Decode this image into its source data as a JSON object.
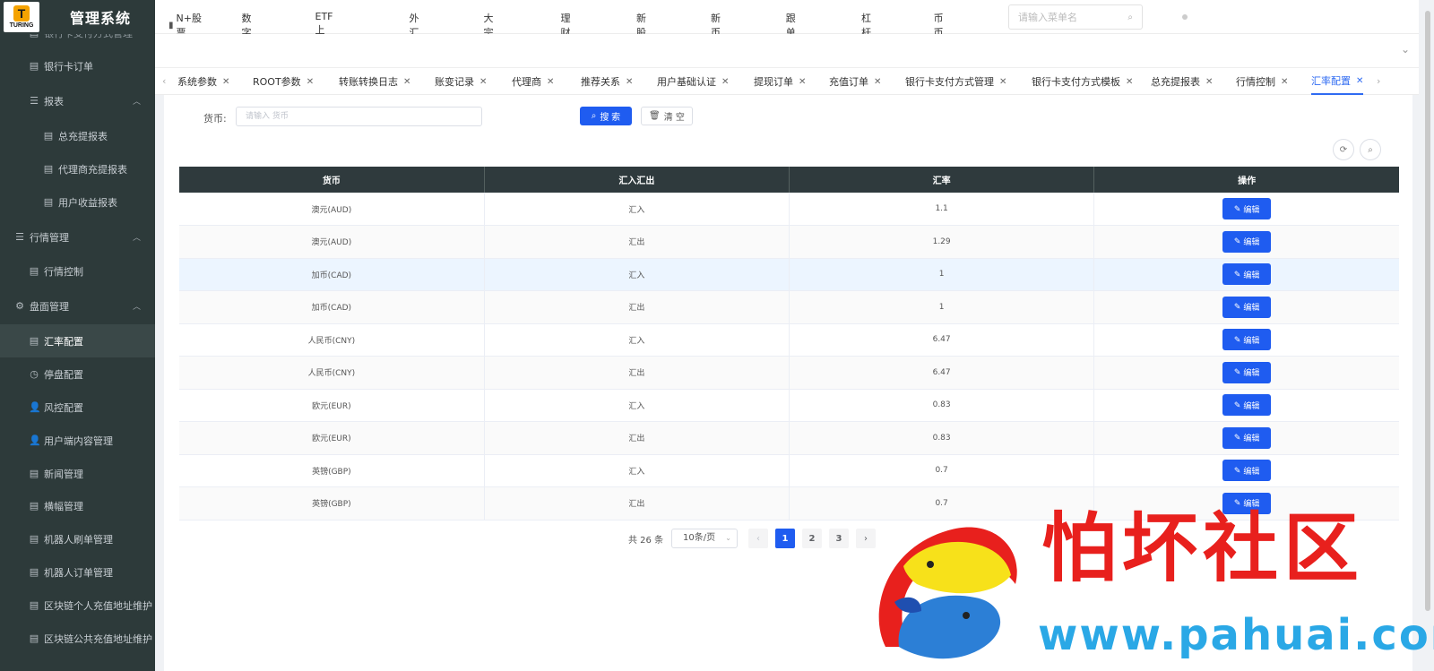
{
  "app": {
    "logo_text": "TURING",
    "logo_mark": "T",
    "title": "管理系统"
  },
  "sidebar": {
    "items": [
      {
        "label": "银行卡支付方式管理",
        "icon": "doc-icon",
        "level": 2
      },
      {
        "label": "银行卡订单",
        "icon": "doc-icon",
        "level": 2
      },
      {
        "label": "报表",
        "icon": "list-icon",
        "level": 2,
        "expanded": true
      },
      {
        "label": "总充提报表",
        "icon": "doc-icon",
        "level": 3
      },
      {
        "label": "代理商充提报表",
        "icon": "doc-icon",
        "level": 3
      },
      {
        "label": "用户收益报表",
        "icon": "doc-icon",
        "level": 3
      },
      {
        "label": "行情管理",
        "icon": "list-icon",
        "level": 1,
        "expanded": true
      },
      {
        "label": "行情控制",
        "icon": "doc-icon",
        "level": 2
      },
      {
        "label": "盘面管理",
        "icon": "gear-icon",
        "level": 1,
        "expanded": true
      },
      {
        "label": "汇率配置",
        "icon": "doc-icon",
        "level": 2,
        "active": true
      },
      {
        "label": "停盘配置",
        "icon": "clock-icon",
        "level": 2
      },
      {
        "label": "风控配置",
        "icon": "user-icon",
        "level": 2
      },
      {
        "label": "用户端内容管理",
        "icon": "user-icon",
        "level": 2
      },
      {
        "label": "新闻管理",
        "icon": "doc-icon",
        "level": 2
      },
      {
        "label": "横幅管理",
        "icon": "doc-icon",
        "level": 2
      },
      {
        "label": "机器人刷单管理",
        "icon": "doc-icon",
        "level": 2
      },
      {
        "label": "机器人订单管理",
        "icon": "doc-icon",
        "level": 2
      },
      {
        "label": "区块链个人充值地址维护",
        "icon": "doc-icon",
        "level": 2
      },
      {
        "label": "区块链公共充值地址维护",
        "icon": "doc-icon",
        "level": 2
      }
    ]
  },
  "topnav": {
    "items": [
      {
        "label": "N+股票",
        "icon": "bar-chart-icon"
      },
      {
        "label": "数字货币",
        "icon": "bar-chart-icon"
      },
      {
        "label": "ETF上市基金",
        "icon": "bar-chart-icon"
      },
      {
        "label": "外汇对冲",
        "icon": "bar-chart-icon"
      },
      {
        "label": "大宗交易",
        "icon": "bar-chart-icon"
      },
      {
        "label": "理财业务",
        "icon": "doc-icon"
      },
      {
        "label": "新股申购",
        "icon": "gear-icon"
      },
      {
        "label": "新币发行",
        "icon": "gear-icon"
      },
      {
        "label": "跟单交易",
        "icon": "clock-icon"
      },
      {
        "label": "杠杆交易",
        "icon": "leverage-icon"
      },
      {
        "label": "币币交易",
        "icon": "pin-icon"
      }
    ],
    "search_placeholder": "请输入菜单名"
  },
  "tabs": [
    {
      "label": "系统参数"
    },
    {
      "label": "ROOT参数"
    },
    {
      "label": "转账转换日志"
    },
    {
      "label": "账变记录"
    },
    {
      "label": "代理商"
    },
    {
      "label": "推荐关系"
    },
    {
      "label": "用户基础认证"
    },
    {
      "label": "提现订单"
    },
    {
      "label": "充值订单"
    },
    {
      "label": "银行卡支付方式管理"
    },
    {
      "label": "银行卡支付方式模板"
    },
    {
      "label": "总充提报表"
    },
    {
      "label": "行情控制"
    },
    {
      "label": "汇率配置",
      "active": true
    }
  ],
  "filter": {
    "label": "货币:",
    "placeholder": "请输入 货币",
    "search_label": "搜 索",
    "clear_label": "清 空"
  },
  "table": {
    "columns": [
      "货币",
      "汇入汇出",
      "汇率",
      "操作"
    ],
    "rows": [
      {
        "currency": "澳元(AUD)",
        "direction": "汇入",
        "rate": "1.1"
      },
      {
        "currency": "澳元(AUD)",
        "direction": "汇出",
        "rate": "1.29"
      },
      {
        "currency": "加币(CAD)",
        "direction": "汇入",
        "rate": "1"
      },
      {
        "currency": "加币(CAD)",
        "direction": "汇出",
        "rate": "1"
      },
      {
        "currency": "人民币(CNY)",
        "direction": "汇入",
        "rate": "6.47"
      },
      {
        "currency": "人民币(CNY)",
        "direction": "汇出",
        "rate": "6.47"
      },
      {
        "currency": "欧元(EUR)",
        "direction": "汇入",
        "rate": "0.83"
      },
      {
        "currency": "欧元(EUR)",
        "direction": "汇出",
        "rate": "0.83"
      },
      {
        "currency": "英镑(GBP)",
        "direction": "汇入",
        "rate": "0.7"
      },
      {
        "currency": "英镑(GBP)",
        "direction": "汇出",
        "rate": "0.7"
      }
    ],
    "edit_label": "编辑",
    "highlighted_row": 2
  },
  "pagination": {
    "total_text": "共 26 条",
    "page_size": "10条/页",
    "pages": [
      "1",
      "2",
      "3"
    ],
    "current": "1"
  },
  "watermark": {
    "title": "怕坏社区",
    "url": "www.pahuai.com"
  },
  "colors": {
    "sidebar_bg": "#2d3a3a",
    "primary": "#1f5cf0",
    "active_tab": "#2f6bf2",
    "table_header": "#2f3a3d",
    "row_highlight": "#ecf5ff"
  }
}
